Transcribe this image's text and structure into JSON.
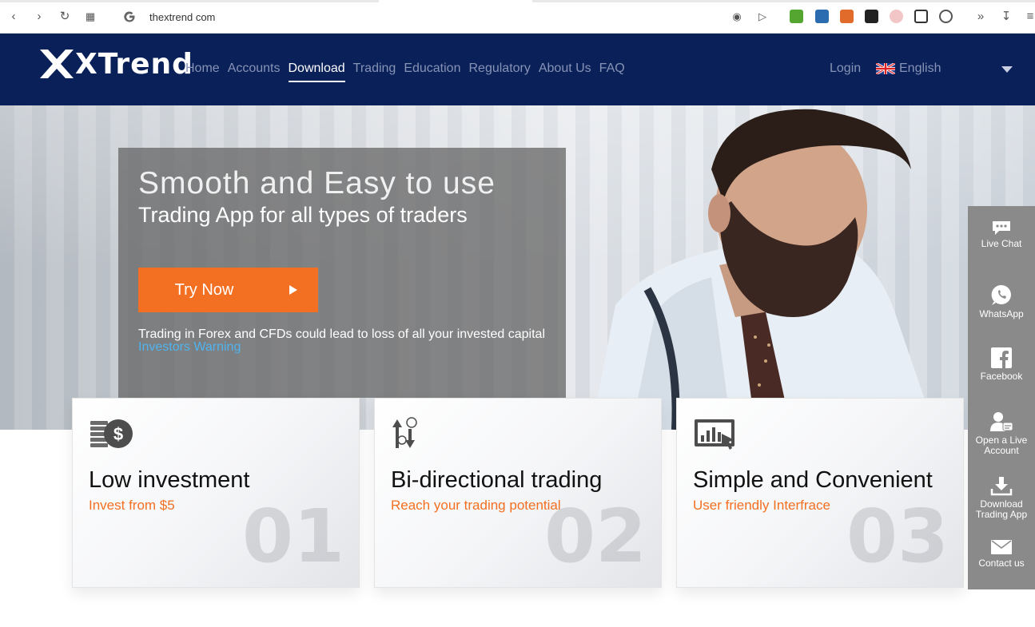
{
  "browser": {
    "url": "thextrend com"
  },
  "header": {
    "logo_text": "XTrend",
    "nav": [
      "Home",
      "Accounts",
      "Download",
      "Trading",
      "Education",
      "Regulatory",
      "About Us",
      "FAQ"
    ],
    "active_nav": "Download",
    "login_label": "Login",
    "language_label": "English"
  },
  "hero": {
    "title_line1": "Smooth and Easy to use",
    "title_line2": "Trading App for all types of traders",
    "cta_label": "Try Now",
    "risk_text": "Trading in Forex and CFDs could lead to loss of all your invested capital",
    "warning_link": "Investors Warning"
  },
  "cards": [
    {
      "title": "Low investment",
      "subtitle": "Invest from $5",
      "number": "01",
      "icon": "coin-stack-icon"
    },
    {
      "title": "Bi-directional trading",
      "subtitle": "Reach your trading potential",
      "number": "02",
      "icon": "up-down-arrows-icon"
    },
    {
      "title": "Simple and Convenient",
      "subtitle": "User friendly Interfrace",
      "number": "03",
      "icon": "touch-chart-icon"
    }
  ],
  "side_widget": {
    "items": [
      {
        "label": "Live Chat",
        "icon": "chat-icon"
      },
      {
        "label": "WhatsApp",
        "icon": "whatsapp-icon"
      },
      {
        "label": "Facebook",
        "icon": "facebook-icon"
      },
      {
        "label": "Open a Live Account",
        "icon": "user-card-icon"
      },
      {
        "label": "Download Trading App",
        "icon": "download-icon"
      },
      {
        "label": "Contact us",
        "icon": "mail-icon"
      }
    ]
  },
  "colors": {
    "header_bg": "#0a2059",
    "accent": "#f36f21",
    "link": "#4fb4f0",
    "side_bg": "#8a8a8a"
  }
}
